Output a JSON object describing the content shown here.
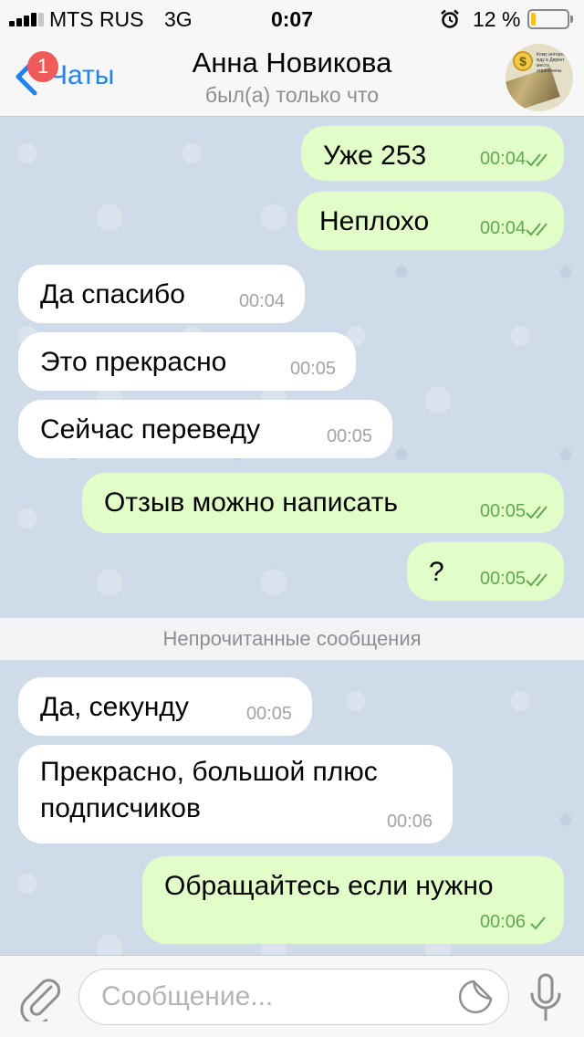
{
  "status_bar": {
    "carrier": "MTS RUS",
    "network": "3G",
    "time": "0:07",
    "battery_percent": "12 %",
    "battery_level": 0.12
  },
  "nav": {
    "back_label": "Чаты",
    "unread_badge": "1",
    "title": "Анна Новикова",
    "subtitle": "был(а) только что",
    "avatar_coin": "$",
    "avatar_text": "Кому интересно жду в Директ места ограничены"
  },
  "messages": [
    {
      "dir": "out",
      "text": "Уже 253",
      "time": "00:04",
      "status": "read"
    },
    {
      "dir": "out",
      "text": "Неплохо",
      "time": "00:04",
      "status": "read"
    },
    {
      "dir": "in",
      "text": "Да спасибо",
      "time": "00:04"
    },
    {
      "dir": "in",
      "text": "Это прекрасно",
      "time": "00:05"
    },
    {
      "dir": "in",
      "text": "Сейчас переведу",
      "time": "00:05"
    },
    {
      "dir": "out",
      "text": "Отзыв можно написать",
      "time": "00:05",
      "status": "read"
    },
    {
      "dir": "out",
      "text": "?",
      "time": "00:05",
      "status": "read"
    },
    {
      "dir": "in",
      "text": "Да, секунду",
      "time": "00:05"
    },
    {
      "dir": "in",
      "text": "Прекрасно, большой плюс\nподписчиков",
      "time": "00:06"
    },
    {
      "dir": "out",
      "text": "Обращайтесь если нужно",
      "time": "00:06",
      "status": "sent"
    }
  ],
  "unread_divider": "Непрочитанные сообщения",
  "input": {
    "placeholder": "Сообщение...",
    "value": ""
  },
  "colors": {
    "accent": "#1f84ee",
    "badge": "#ef5b5b",
    "outgoing_bubble": "#e2fec8",
    "incoming_bubble": "#ffffff",
    "outgoing_time": "#5ea952",
    "chat_background": "#cfdbe8",
    "battery_fill": "#f5c21b"
  },
  "icons": {
    "back": "chevron-left-icon",
    "attach": "paperclip-icon",
    "sticker": "sticker-icon",
    "mic": "microphone-icon",
    "alarm": "alarm-clock-icon",
    "read": "double-check-icon",
    "sent": "single-check-icon"
  }
}
